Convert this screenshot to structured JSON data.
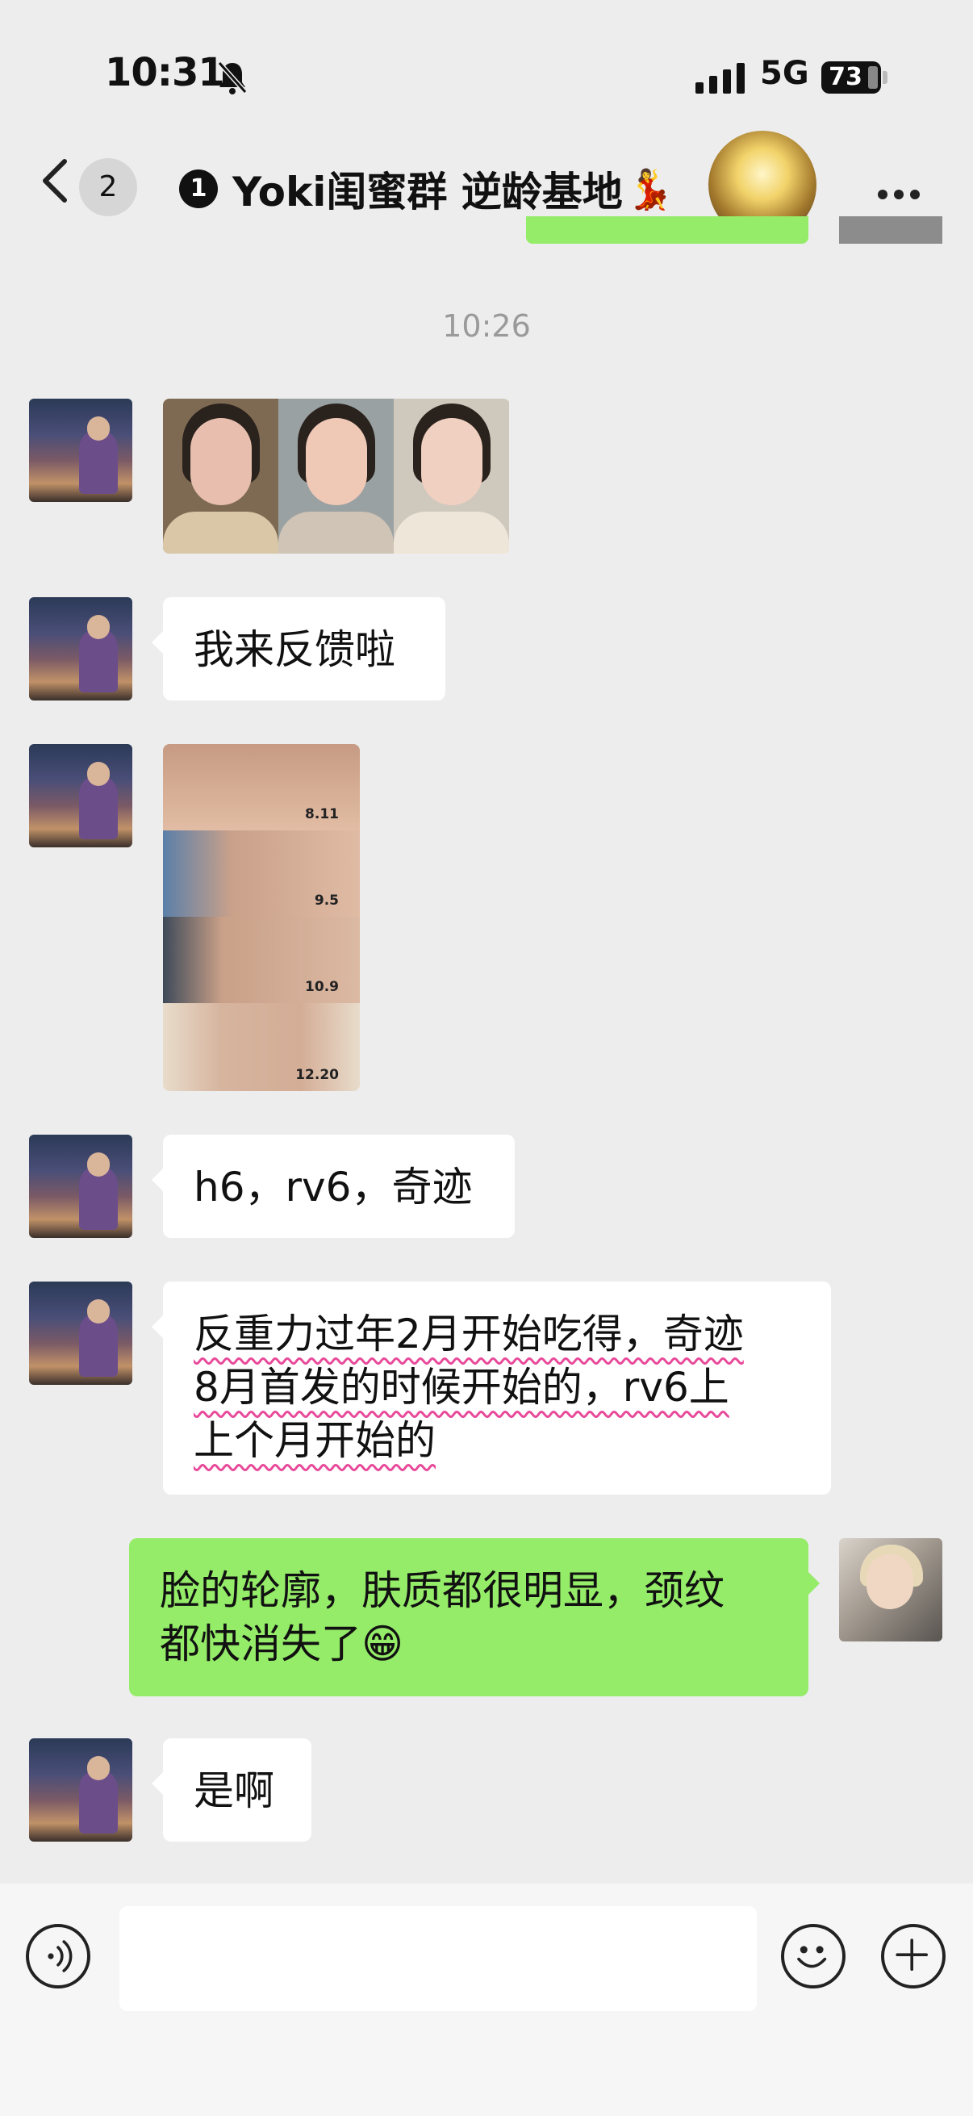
{
  "status": {
    "time": "10:31",
    "network": "5G",
    "battery": "73"
  },
  "nav": {
    "unread": "2",
    "title": "Yoki闺蜜群 逆龄基地",
    "title_mark": "1",
    "title_emoji": "💃"
  },
  "chat": {
    "timestamp": "10:26",
    "msg_feedback": "我来反馈啦",
    "neck_labels": [
      "8.11",
      "9.5",
      "10.9",
      "12.20"
    ],
    "msg_products": "h6，rv6，奇迹",
    "msg_timeline_1": "反重力过年2月开始吃得，奇迹",
    "msg_timeline_2": "8月首发的时候开始的，rv6上",
    "msg_timeline_3": "上个月开始的",
    "msg_mine_1": "脸的轮廓，肤质都很明显，颈纹",
    "msg_mine_2": "都快消失了",
    "msg_mine_emoji": "😁",
    "msg_yes": "是啊"
  },
  "input": {
    "placeholder": ""
  },
  "icons": [
    "back-chevron-icon",
    "mute-bell-icon",
    "signal-icon",
    "more-icon",
    "voice-icon",
    "emoji-icon",
    "plus-icon"
  ]
}
